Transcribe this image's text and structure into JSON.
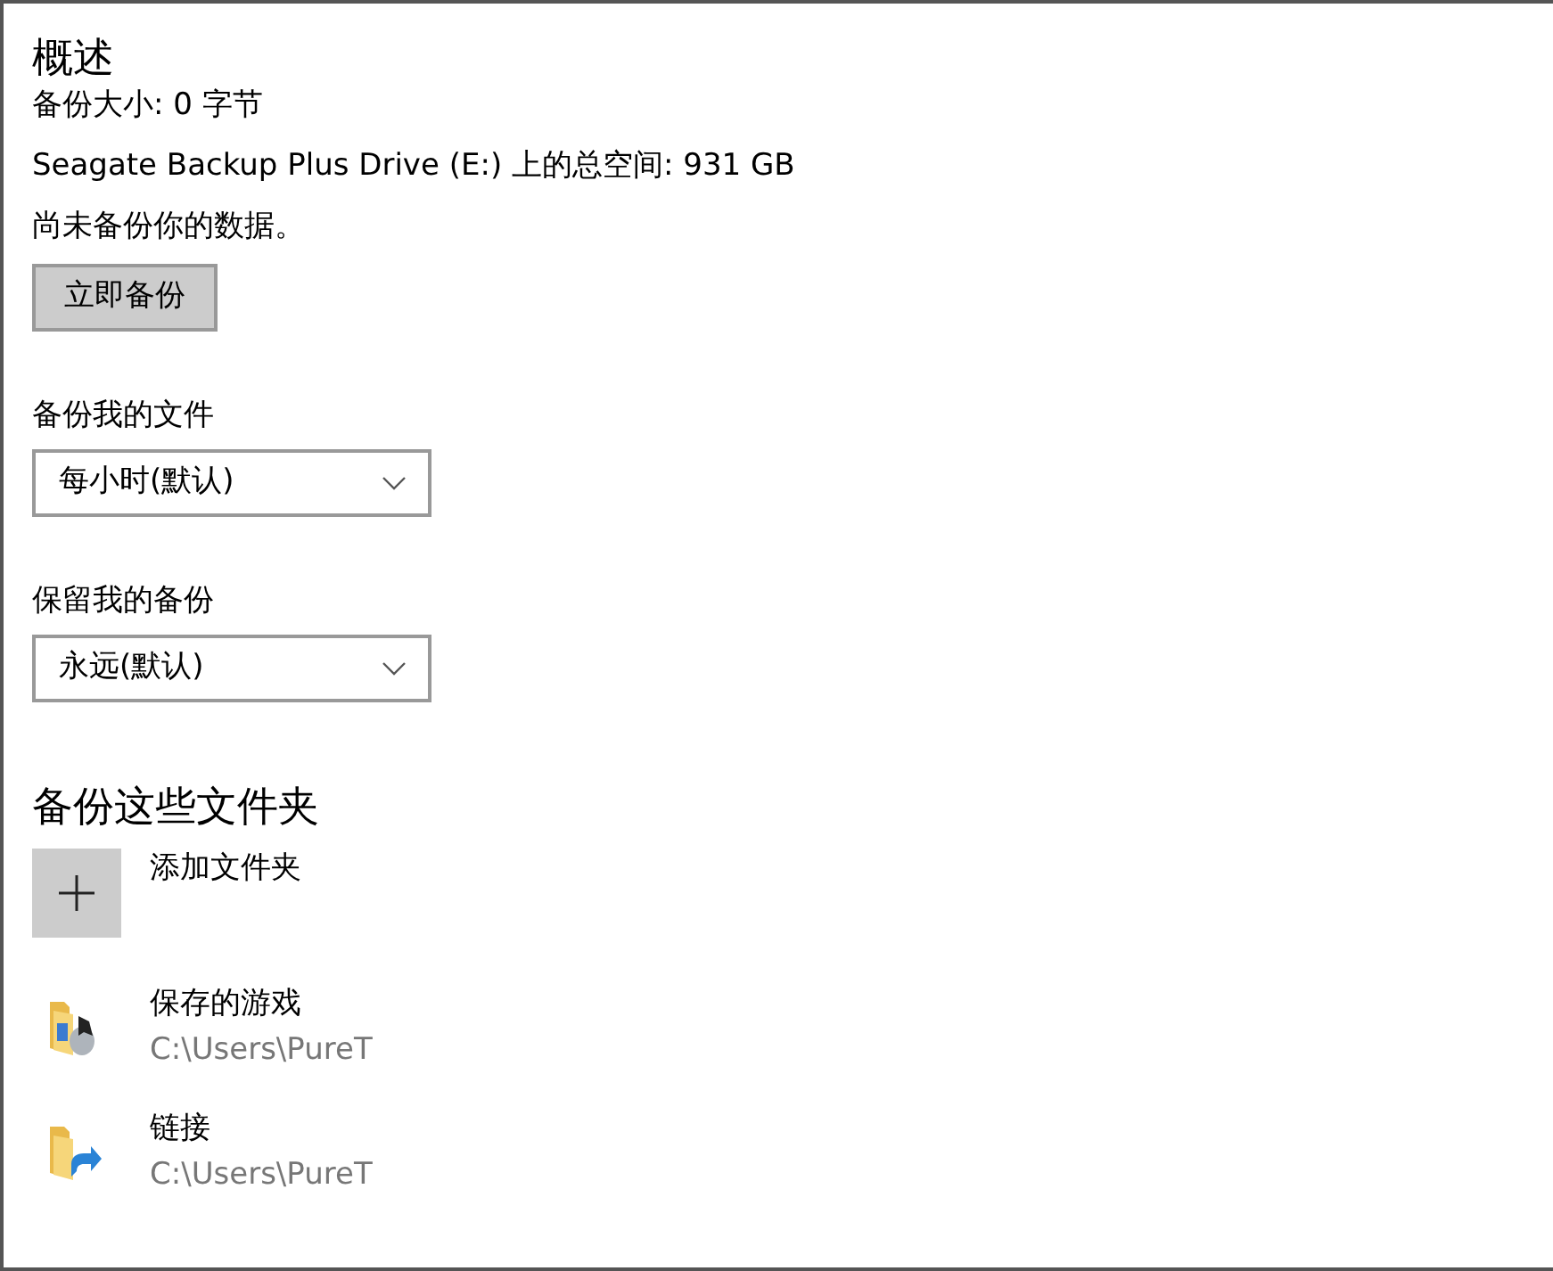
{
  "overview": {
    "title": "概述",
    "lines": [
      "备份大小: 0 字节",
      "Seagate Backup Plus Drive (E:) 上的总空间: 931 GB",
      "尚未备份你的数据。"
    ],
    "button": "立即备份"
  },
  "settings": [
    {
      "label": "备份我的文件",
      "value": "每小时(默认)"
    },
    {
      "label": "保留我的备份",
      "value": "永远(默认)"
    }
  ],
  "folders": {
    "title": "备份这些文件夹",
    "add_label": "添加文件夹",
    "items": [
      {
        "kind": "games",
        "name": "保存的游戏",
        "path": "C:\\Users\\PureT"
      },
      {
        "kind": "link",
        "name": "链接",
        "path": "C:\\Users\\PureT"
      }
    ]
  }
}
